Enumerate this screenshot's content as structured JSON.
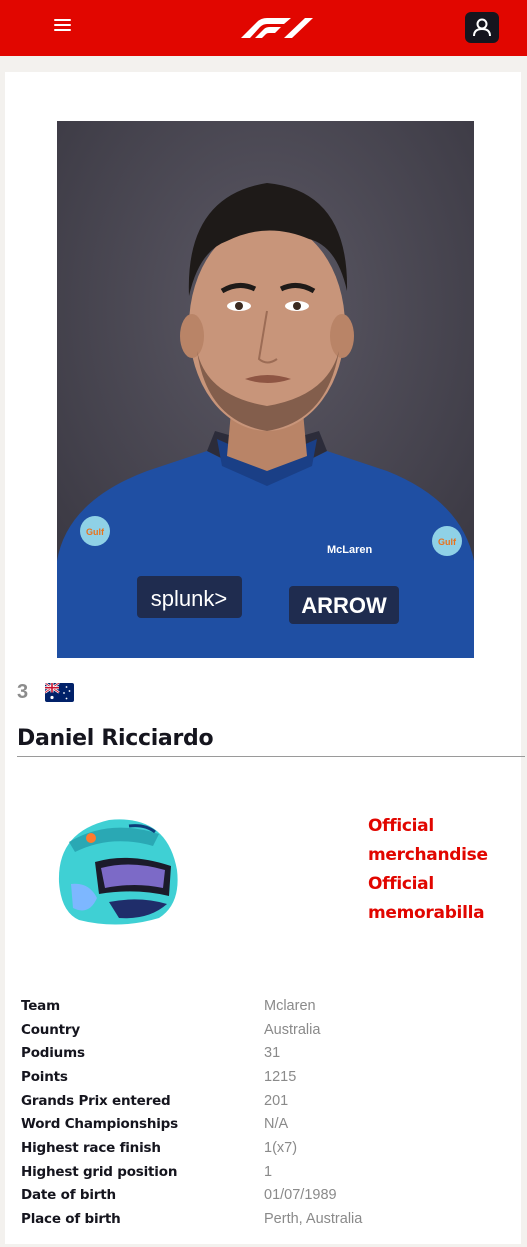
{
  "header": {
    "menu_icon": "hamburger-menu-icon",
    "logo": "F1",
    "user_icon": "user-account-icon",
    "brand_color": "#e10600"
  },
  "driver": {
    "number": "3",
    "flag": "australia-flag-icon",
    "name": "Daniel Ricciardo",
    "portrait_sponsors": [
      "splunk>",
      "ARROW",
      "McLaren",
      "Gulf"
    ]
  },
  "links": {
    "merchandise": "Official merchandise",
    "memorabilia": "Official memorabilla"
  },
  "stats": [
    {
      "label": "Team",
      "value": "Mclaren"
    },
    {
      "label": "Country",
      "value": "Australia"
    },
    {
      "label": "Podiums",
      "value": "31"
    },
    {
      "label": "Points",
      "value": "1215"
    },
    {
      "label": "Grands Prix entered",
      "value": "201"
    },
    {
      "label": "Word Championships",
      "value": "N/A"
    },
    {
      "label": "Highest race finish",
      "value": "1(x7)"
    },
    {
      "label": "Highest grid position",
      "value": "1"
    },
    {
      "label": "Date of birth",
      "value": "01/07/1989"
    },
    {
      "label": "Place of birth",
      "value": "Perth, Australia"
    }
  ]
}
